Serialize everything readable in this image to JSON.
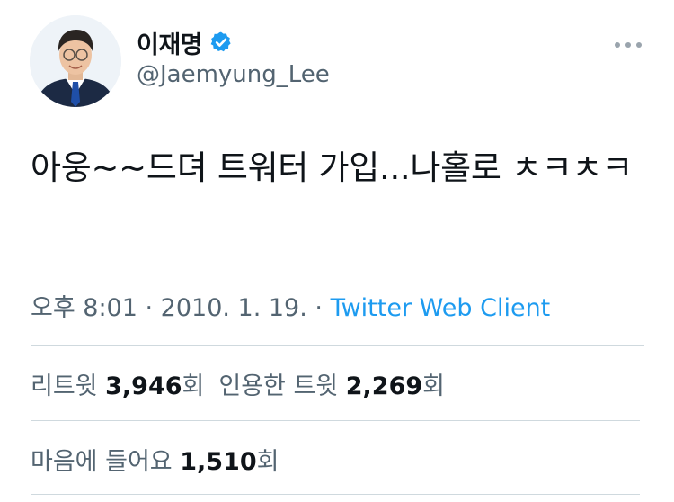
{
  "author": {
    "display_name": "이재명",
    "handle": "@Jaemyung_Lee",
    "avatar_icon": "profile-photo",
    "verified_icon": "verified-badge-icon",
    "verified_color": "#1d9bf0"
  },
  "more_icon": "more-options-icon",
  "tweet": {
    "text": "아웅~~드뎌 트워터 가입...나홀로 ㅊㅋㅊㅋ"
  },
  "meta": {
    "time": "오후 8:01",
    "separator1": " · ",
    "date": "2010. 1. 19.",
    "separator2": " · ",
    "source": "Twitter Web Client"
  },
  "stats": {
    "retweets_label": "리트윗 ",
    "retweets_count": "3,946",
    "retweets_unit": "회",
    "quotes_label": "인용한 트윗 ",
    "quotes_count": "2,269",
    "quotes_unit": "회",
    "likes_label": "마음에 들어요 ",
    "likes_count": "1,510",
    "likes_unit": "회"
  },
  "colors": {
    "text": "#0f1419",
    "secondary": "#536471",
    "link": "#1d9bf0",
    "divider": "#cfd9de"
  }
}
